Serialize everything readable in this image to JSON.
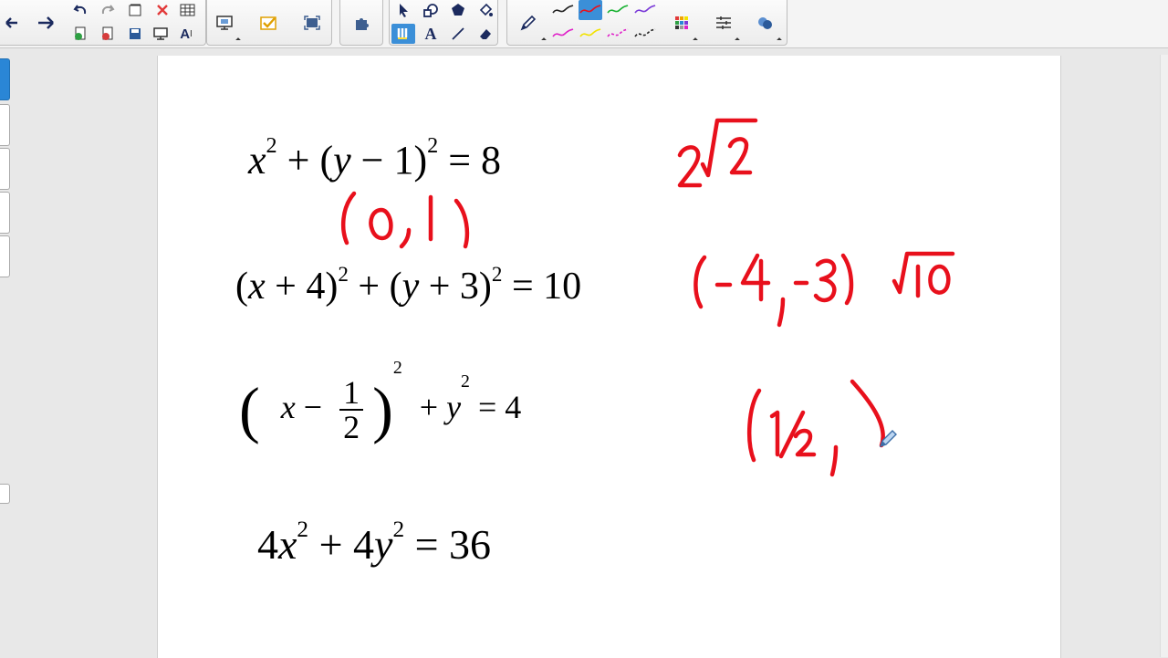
{
  "toolbar": {
    "buttons": [
      "back",
      "forward",
      "undo",
      "redo",
      "insert-page",
      "delete",
      "table",
      "add-page",
      "remove-page",
      "save",
      "display",
      "text-tool",
      "screen-shade",
      "check-tool",
      "capture",
      "add-on",
      "select",
      "shapes",
      "polygon",
      "fill",
      "pens",
      "text",
      "line",
      "eraser",
      "pen",
      "color-palette",
      "line-style",
      "magic"
    ]
  },
  "equations": {
    "eq1": {
      "a": "x",
      "exp1": "2",
      "b": "+ (",
      "c": "y",
      "d": " − 1)",
      "exp2": "2",
      "e": " = 8"
    },
    "eq2": {
      "a": "(",
      "b": "x",
      "c": " + 4)",
      "exp1": "2",
      "d": " + (",
      "e": "y",
      "f": " + 3)",
      "exp2": "2",
      "g": " = 10"
    },
    "eq3": {
      "lp": "(",
      "a": "x",
      "b": " − ",
      "num": "1",
      "den": "2",
      "rp": ")",
      "exp1": "2",
      "c": " + ",
      "d": "y",
      "exp2": "2",
      "e": " = 4"
    },
    "eq4": {
      "a": "4",
      "b": "x",
      "exp1": "2",
      "c": " + 4",
      "d": "y",
      "exp2": "2",
      "e": " = 36"
    }
  },
  "colors": {
    "ink": "#e8101c",
    "accent": "#2a86d6"
  }
}
